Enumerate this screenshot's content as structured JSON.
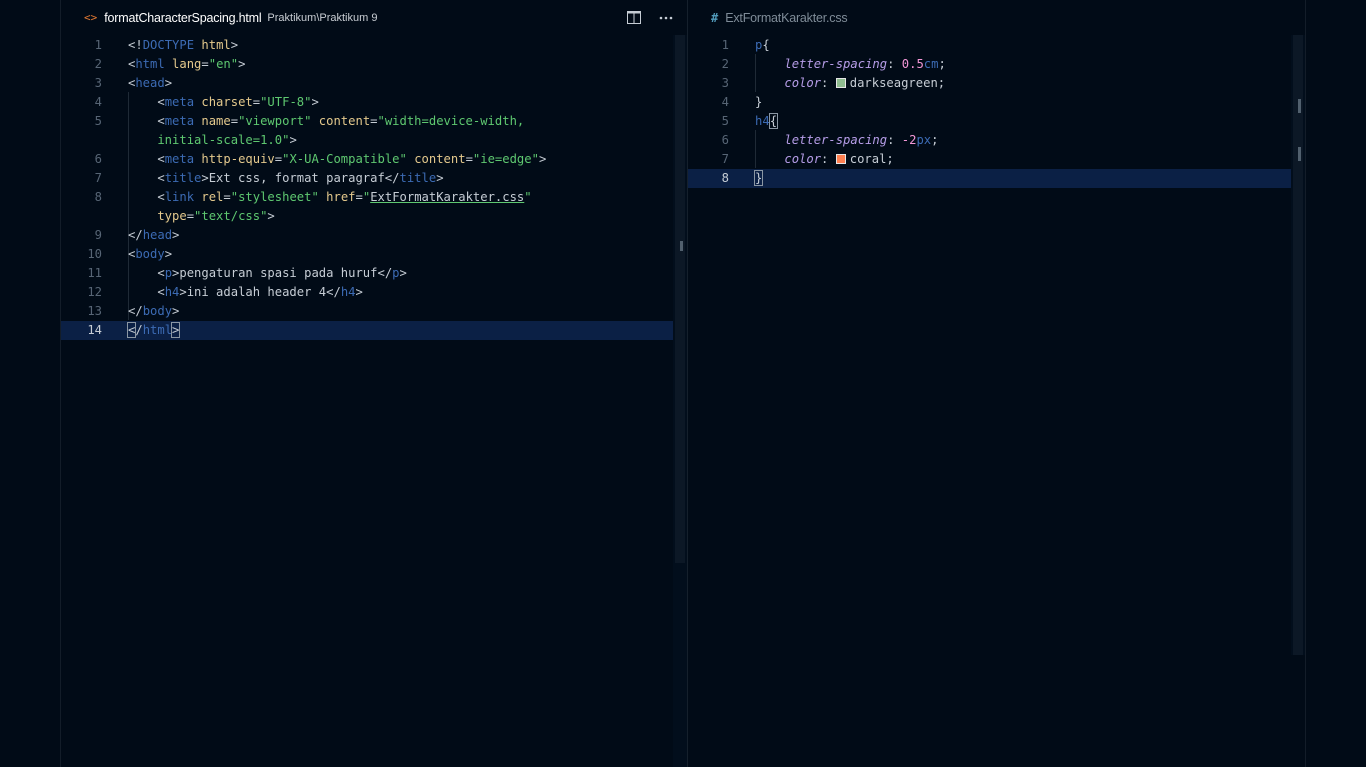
{
  "left_editor": {
    "tab": {
      "icon": "html-code-icon",
      "glyph": "<>",
      "filename": "formatCharacterSpacing.html",
      "path": "Praktikum\\Praktikum 9"
    },
    "actions": {
      "split_icon": "split-editor-icon",
      "more_icon": "more-actions-icon"
    },
    "current_line": 14,
    "lines": [
      {
        "num": "1",
        "tokens": [
          {
            "t": "<!",
            "c": "punc"
          },
          {
            "t": "DOCTYPE",
            "c": "tag"
          },
          {
            "t": " html",
            "c": "attr"
          },
          {
            "t": ">",
            "c": "punc"
          }
        ]
      },
      {
        "num": "2",
        "tokens": [
          {
            "t": "<",
            "c": "punc"
          },
          {
            "t": "html",
            "c": "tag"
          },
          {
            "t": " lang",
            "c": "attr"
          },
          {
            "t": "=",
            "c": "punc"
          },
          {
            "t": "\"en\"",
            "c": "str"
          },
          {
            "t": ">",
            "c": "punc"
          }
        ]
      },
      {
        "num": "3",
        "tokens": [
          {
            "t": "<",
            "c": "punc"
          },
          {
            "t": "head",
            "c": "tag"
          },
          {
            "t": ">",
            "c": "punc"
          }
        ]
      },
      {
        "num": "4",
        "tokens": [
          {
            "t": "    <",
            "c": "punc"
          },
          {
            "t": "meta",
            "c": "tag"
          },
          {
            "t": " charset",
            "c": "attr"
          },
          {
            "t": "=",
            "c": "punc"
          },
          {
            "t": "\"UTF-8\"",
            "c": "str"
          },
          {
            "t": ">",
            "c": "punc"
          }
        ]
      },
      {
        "num": "5",
        "tokens": [
          {
            "t": "    <",
            "c": "punc"
          },
          {
            "t": "meta",
            "c": "tag"
          },
          {
            "t": " name",
            "c": "attr"
          },
          {
            "t": "=",
            "c": "punc"
          },
          {
            "t": "\"viewport\"",
            "c": "str"
          },
          {
            "t": " content",
            "c": "attr"
          },
          {
            "t": "=",
            "c": "punc"
          },
          {
            "t": "\"width=device-width,",
            "c": "str"
          }
        ]
      },
      {
        "num": "",
        "tokens": [
          {
            "t": "    initial-scale=1.0\"",
            "c": "str"
          },
          {
            "t": ">",
            "c": "punc"
          }
        ]
      },
      {
        "num": "6",
        "tokens": [
          {
            "t": "    <",
            "c": "punc"
          },
          {
            "t": "meta",
            "c": "tag"
          },
          {
            "t": " http-equiv",
            "c": "attr"
          },
          {
            "t": "=",
            "c": "punc"
          },
          {
            "t": "\"X-UA-Compatible\"",
            "c": "str"
          },
          {
            "t": " content",
            "c": "attr"
          },
          {
            "t": "=",
            "c": "punc"
          },
          {
            "t": "\"ie=edge\"",
            "c": "str"
          },
          {
            "t": ">",
            "c": "punc"
          }
        ]
      },
      {
        "num": "7",
        "tokens": [
          {
            "t": "    <",
            "c": "punc"
          },
          {
            "t": "title",
            "c": "tag"
          },
          {
            "t": ">Ext css, format paragraf</",
            "c": "punc"
          },
          {
            "t": "title",
            "c": "tag"
          },
          {
            "t": ">",
            "c": "punc"
          }
        ]
      },
      {
        "num": "8",
        "tokens": [
          {
            "t": "    <",
            "c": "punc"
          },
          {
            "t": "link",
            "c": "tag"
          },
          {
            "t": " rel",
            "c": "attr"
          },
          {
            "t": "=",
            "c": "punc"
          },
          {
            "t": "\"stylesheet\"",
            "c": "str"
          },
          {
            "t": " href",
            "c": "attr"
          },
          {
            "t": "=",
            "c": "punc"
          },
          {
            "t": "\"",
            "c": "str"
          },
          {
            "t": "ExtFormatKarakter.css",
            "c": "link"
          },
          {
            "t": "\"",
            "c": "str"
          }
        ]
      },
      {
        "num": "",
        "tokens": [
          {
            "t": "    type",
            "c": "attr"
          },
          {
            "t": "=",
            "c": "punc"
          },
          {
            "t": "\"text/css\"",
            "c": "str"
          },
          {
            "t": ">",
            "c": "punc"
          }
        ]
      },
      {
        "num": "9",
        "tokens": [
          {
            "t": "</",
            "c": "punc"
          },
          {
            "t": "head",
            "c": "tag"
          },
          {
            "t": ">",
            "c": "punc"
          }
        ]
      },
      {
        "num": "10",
        "tokens": [
          {
            "t": "<",
            "c": "punc"
          },
          {
            "t": "body",
            "c": "tag"
          },
          {
            "t": ">",
            "c": "punc"
          }
        ]
      },
      {
        "num": "11",
        "tokens": [
          {
            "t": "    <",
            "c": "punc"
          },
          {
            "t": "p",
            "c": "tag"
          },
          {
            "t": ">pengaturan spasi pada huruf</",
            "c": "punc"
          },
          {
            "t": "p",
            "c": "tag"
          },
          {
            "t": ">",
            "c": "punc"
          }
        ]
      },
      {
        "num": "12",
        "tokens": [
          {
            "t": "    <",
            "c": "punc"
          },
          {
            "t": "h4",
            "c": "tag"
          },
          {
            "t": ">ini adalah header 4</",
            "c": "punc"
          },
          {
            "t": "h4",
            "c": "tag"
          },
          {
            "t": ">",
            "c": "punc"
          }
        ]
      },
      {
        "num": "13",
        "tokens": [
          {
            "t": "</",
            "c": "punc"
          },
          {
            "t": "body",
            "c": "tag"
          },
          {
            "t": ">",
            "c": "punc"
          }
        ]
      },
      {
        "num": "14",
        "tokens": [
          {
            "t": "<",
            "c": "punc bracket"
          },
          {
            "t": "/",
            "c": "punc"
          },
          {
            "t": "html",
            "c": "tag"
          },
          {
            "t": ">",
            "c": "punc bracket"
          }
        ]
      }
    ]
  },
  "right_editor": {
    "tab": {
      "icon": "css-hash-icon",
      "glyph": "#",
      "filename": "ExtFormatKarakter.css"
    },
    "current_line": 8,
    "lines": [
      {
        "num": "1",
        "tokens": [
          {
            "t": "p",
            "c": "tag"
          },
          {
            "t": "{",
            "c": "punc"
          }
        ]
      },
      {
        "num": "2",
        "tokens": [
          {
            "t": "    ",
            "c": "punc"
          },
          {
            "t": "letter-spacing",
            "c": "prop"
          },
          {
            "t": ": ",
            "c": "punc"
          },
          {
            "t": "0.5",
            "c": "num"
          },
          {
            "t": "cm",
            "c": "unit"
          },
          {
            "t": ";",
            "c": "punc"
          }
        ]
      },
      {
        "num": "3",
        "tokens": [
          {
            "t": "    ",
            "c": "punc"
          },
          {
            "t": "color",
            "c": "prop"
          },
          {
            "t": ": ",
            "c": "punc"
          },
          {
            "t": "",
            "c": "swatch",
            "color": "#8fbc8f"
          },
          {
            "t": "darkseagreen",
            "c": "punc"
          },
          {
            "t": ";",
            "c": "punc"
          }
        ]
      },
      {
        "num": "4",
        "tokens": [
          {
            "t": "}",
            "c": "punc"
          }
        ]
      },
      {
        "num": "5",
        "tokens": [
          {
            "t": "h4",
            "c": "tag"
          },
          {
            "t": "{",
            "c": "punc bracket"
          }
        ]
      },
      {
        "num": "6",
        "tokens": [
          {
            "t": "    ",
            "c": "punc"
          },
          {
            "t": "letter-spacing",
            "c": "prop"
          },
          {
            "t": ": ",
            "c": "punc"
          },
          {
            "t": "-2",
            "c": "num"
          },
          {
            "t": "px",
            "c": "unit"
          },
          {
            "t": ";",
            "c": "punc"
          }
        ]
      },
      {
        "num": "7",
        "tokens": [
          {
            "t": "    ",
            "c": "punc"
          },
          {
            "t": "color",
            "c": "prop"
          },
          {
            "t": ": ",
            "c": "punc"
          },
          {
            "t": "",
            "c": "swatch",
            "color": "#ff7f50"
          },
          {
            "t": "coral",
            "c": "punc"
          },
          {
            "t": ";",
            "c": "punc"
          }
        ]
      },
      {
        "num": "8",
        "tokens": [
          {
            "t": "}",
            "c": "punc bracket"
          }
        ]
      }
    ]
  },
  "colors": {
    "background": "#010b17",
    "current_line": "#0b2045",
    "tag": "#3c6bb4",
    "attribute": "#e4c98d",
    "string": "#5ec870",
    "property": "#b69de8",
    "number": "#f397d6"
  }
}
